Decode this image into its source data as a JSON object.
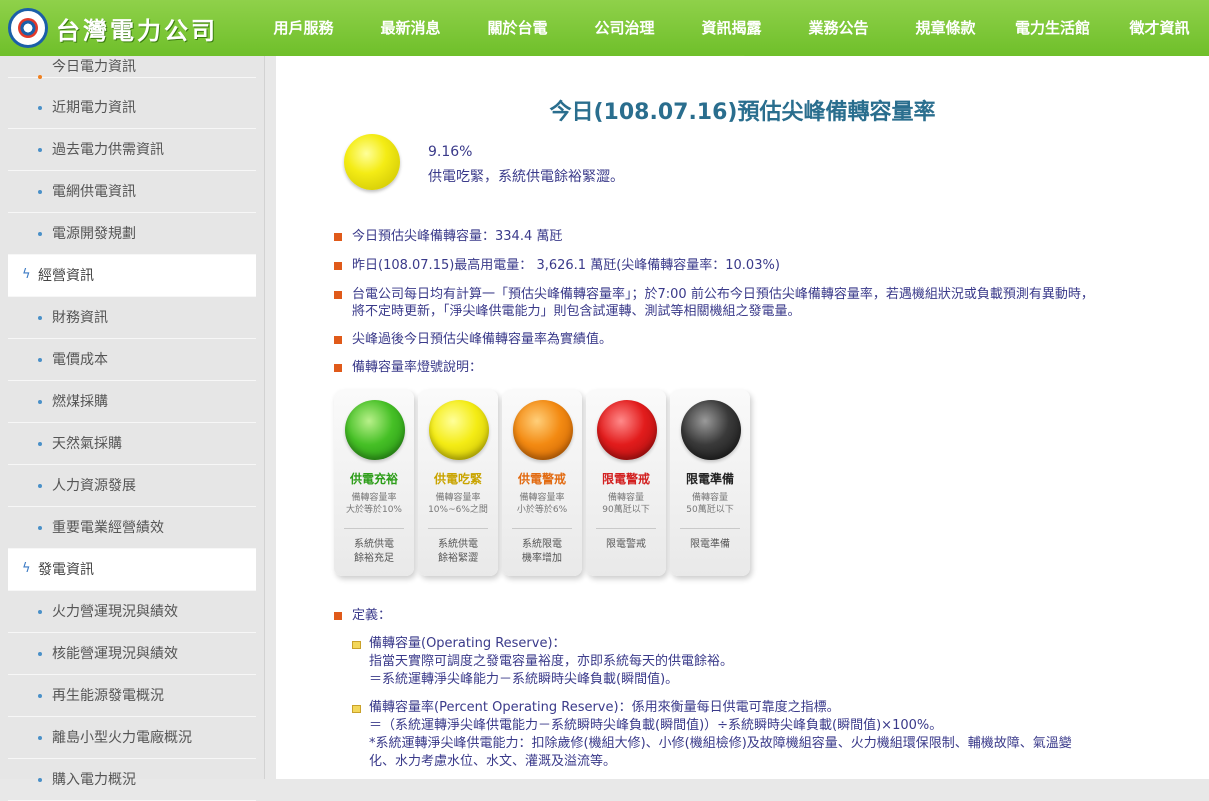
{
  "header": {
    "logo_text": "台灣電力公司",
    "nav": [
      "用戶服務",
      "最新消息",
      "關於台電",
      "公司治理",
      "資訊揭露",
      "業務公告",
      "規章條款",
      "電力生活館",
      "徵才資訊"
    ],
    "active_nav": "資訊揭露"
  },
  "sidebar": {
    "items": [
      {
        "type": "sub",
        "label": "今日電力資訊",
        "current": true
      },
      {
        "type": "sub",
        "label": "近期電力資訊"
      },
      {
        "type": "sub",
        "label": "過去電力供需資訊"
      },
      {
        "type": "sub",
        "label": "電網供電資訊"
      },
      {
        "type": "sub",
        "label": "電源開發規劃"
      },
      {
        "type": "cat",
        "label": "經營資訊"
      },
      {
        "type": "sub",
        "label": "財務資訊"
      },
      {
        "type": "sub",
        "label": "電價成本"
      },
      {
        "type": "sub",
        "label": "燃煤採購"
      },
      {
        "type": "sub",
        "label": "天然氣採購"
      },
      {
        "type": "sub",
        "label": "人力資源發展"
      },
      {
        "type": "sub",
        "label": "重要電業經營績效"
      },
      {
        "type": "cat",
        "label": "發電資訊"
      },
      {
        "type": "sub",
        "label": "火力營運現況與績效"
      },
      {
        "type": "sub",
        "label": "核能營運現況與績效"
      },
      {
        "type": "sub",
        "label": "再生能源發電概況"
      },
      {
        "type": "sub",
        "label": "離島小型火力電廠概況"
      },
      {
        "type": "sub",
        "label": "購入電力概況"
      }
    ]
  },
  "main": {
    "title": "今日(108.07.16)預估尖峰備轉容量率",
    "rate_value": "9.16%",
    "rate_desc": "供電吃緊，系統供電餘裕緊澀。",
    "lines": [
      "今日預估尖峰備轉容量：334.4 萬瓩",
      "昨日(108.07.15)最高用電量： 3,626.1 萬瓩(尖峰備轉容量率：10.03%)",
      "台電公司每日均有計算一「預估尖峰備轉容量率」；於7:00 前公布今日預估尖峰備轉容量率，若遇機組狀況或負載預測有異動時，",
      "將不定時更新，「淨尖峰供電能力」則包含試運轉、測試等相關機組之發電量。",
      "尖峰過後今日預估尖峰備轉容量率為實績值。",
      "備轉容量率燈號說明："
    ],
    "lights": [
      {
        "name": "供電充裕",
        "color": "#2e9e1a",
        "note1": "備轉容量率",
        "note2": "大於等於10%",
        "foot1": "系統供電",
        "foot2": "餘裕充足"
      },
      {
        "name": "供電吃緊",
        "color": "#c9a400",
        "note1": "備轉容量率",
        "note2": "10%~6%之間",
        "foot1": "系統供電",
        "foot2": "餘裕緊澀"
      },
      {
        "name": "供電警戒",
        "color": "#e26a10",
        "note1": "備轉容量率",
        "note2": "小於等於6%",
        "foot1": "系統限電",
        "foot2": "機率增加"
      },
      {
        "name": "限電警戒",
        "color": "#d21e1e",
        "note1": "備轉容量",
        "note2": "90萬瓩以下",
        "foot1": "限電警戒",
        "foot2": ""
      },
      {
        "name": "限電準備",
        "color": "#222222",
        "note1": "備轉容量",
        "note2": "50萬瓩以下",
        "foot1": "限電準備",
        "foot2": ""
      }
    ],
    "definition_label": "定義：",
    "def1_title": "備轉容量(Operating Reserve)：",
    "def1_line1": "指當天實際可調度之發電容量裕度，亦即系統每天的供電餘裕。",
    "def1_line2": "＝系統運轉淨尖峰能力－系統瞬時尖峰負載(瞬間值)。",
    "def2_title": "備轉容量率(Percent Operating Reserve)：係用來衡量每日供電可靠度之指標。",
    "def2_line1": "＝（系統運轉淨尖峰供電能力－系統瞬時尖峰負載(瞬間值)）÷系統瞬時尖峰負載(瞬間值)×100%。",
    "def2_line2": "*系統運轉淨尖峰供電能力：扣除歲修(機組大修)、小修(機組檢修)及故障機組容量、火力機組環保限制、輔機故障、氣溫變",
    "def2_line3": "化、水力考慮水位、水文、灌溉及溢流等。"
  }
}
